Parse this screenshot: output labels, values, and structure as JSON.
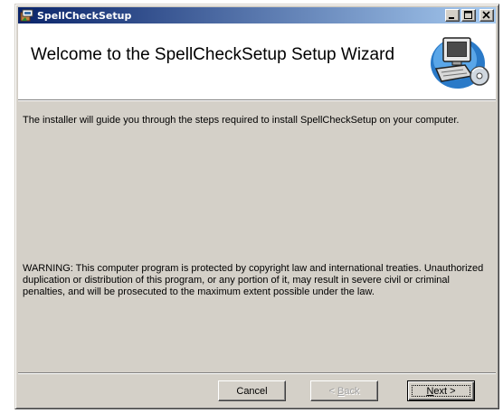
{
  "window": {
    "title": "SpellCheckSetup",
    "title_icon": "installer-box-icon",
    "controls": [
      "minimize-icon",
      "maximize-icon",
      "close-icon"
    ]
  },
  "banner": {
    "heading": "Welcome to the SpellCheckSetup Setup Wizard",
    "graphic": "computer-with-disc-icon"
  },
  "body": {
    "intro": "The installer will guide you through the steps required to install SpellCheckSetup on your computer.",
    "warning": "WARNING: This computer program is protected by copyright law and international treaties. Unauthorized duplication or distribution of this program, or any portion of it, may result in severe civil or criminal penalties, and will be prosecuted to the maximum extent possible under the law."
  },
  "buttons": {
    "cancel": "Cancel",
    "back_accel": "B",
    "back_rest": "ack",
    "back_prefix": "< ",
    "next_accel": "N",
    "next_rest": "ext >"
  },
  "colors": {
    "titlebar_start": "#0a246a",
    "titlebar_end": "#a6caf0",
    "face": "#d4d0c8"
  }
}
